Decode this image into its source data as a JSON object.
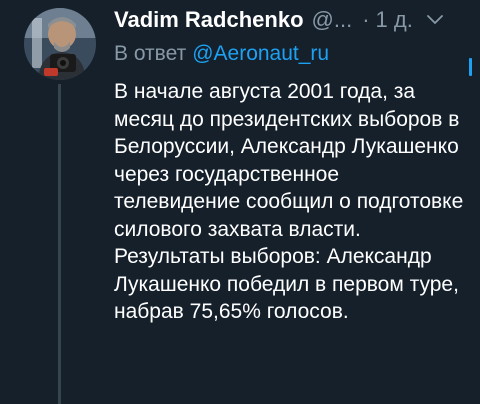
{
  "tweet": {
    "author": {
      "display_name": "Vadim Radchenko",
      "handle": "@...",
      "avatar": "avatar-photo"
    },
    "time": "1 д.",
    "dot": "·",
    "menu_icon": "chevron-down-icon",
    "reply": {
      "prefix": "В ответ",
      "mention": "@Aeronaut_ru"
    },
    "text": {
      "paragraph_1": "В начале августа 2001 года, за месяц до президентских выборов в Белоруссии, Александр Лукашенко через государственное телевидение сообщил о подготовке силового захвата власти.",
      "paragraph_2": "Результаты выборов: Александр Лукашенко победил в первом туре, набрав 75,65% голосов."
    }
  },
  "colors": {
    "background": "#15202b",
    "text": "#ffffff",
    "secondary_text": "#8899a6",
    "accent": "#1da1f2",
    "thread_line": "#38444d"
  }
}
